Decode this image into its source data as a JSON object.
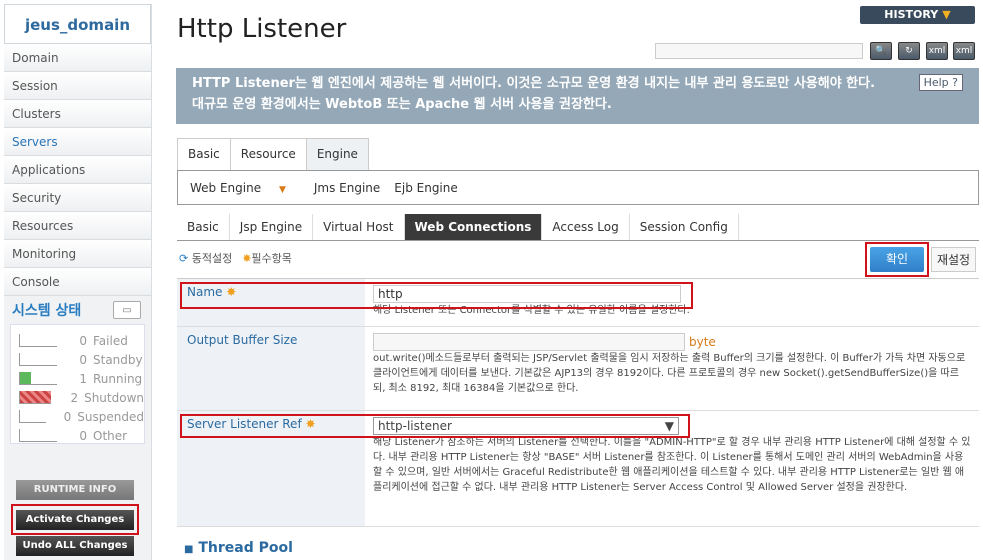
{
  "sidebar": {
    "domain": "jeus_domain",
    "items": [
      {
        "label": "Domain"
      },
      {
        "label": "Session"
      },
      {
        "label": "Clusters"
      },
      {
        "label": "Servers"
      },
      {
        "label": "Applications"
      },
      {
        "label": "Security"
      },
      {
        "label": "Resources"
      },
      {
        "label": "Monitoring"
      },
      {
        "label": "Console"
      }
    ],
    "status_title": "시스템 상태",
    "status": [
      {
        "count": "0",
        "label": "Failed"
      },
      {
        "count": "0",
        "label": "Standby"
      },
      {
        "count": "1",
        "label": "Running"
      },
      {
        "count": "2",
        "label": "Shutdown"
      },
      {
        "count": "0",
        "label": "Suspended"
      },
      {
        "count": "0",
        "label": "Other"
      }
    ],
    "runtime_info": "RUNTIME INFO",
    "activate": "Activate Changes",
    "undo": "Undo ALL Changes"
  },
  "header": {
    "title": "Http Listener",
    "history": "HISTORY",
    "search_placeholder": ""
  },
  "banner": {
    "text": "HTTP Listener는 웹 엔진에서 제공하는 웹 서버이다. 이것은 소규모 운영 환경 내지는 내부 관리 용도로만 사용해야 한다. 대규모 운영 환경에서는 WebtoB 또는 Apache 웹 서버 사용을 권장한다.",
    "help": "Help"
  },
  "tabs": [
    "Basic",
    "Resource",
    "Engine"
  ],
  "engine_tabs": [
    "Web Engine",
    "Jms Engine",
    "Ejb Engine"
  ],
  "web_tabs": [
    "Basic",
    "Jsp Engine",
    "Virtual Host",
    "Web Connections",
    "Access Log",
    "Session Config"
  ],
  "options": {
    "dynamic": "동적설정",
    "required": "필수항목"
  },
  "buttons": {
    "confirm": "확인",
    "reset": "재설정"
  },
  "form": {
    "name": {
      "label": "Name",
      "value": "http",
      "desc": "해당 Listener 또는 Connector를 식별할 수 있는 유일한 이름을 설정한다."
    },
    "buffer": {
      "label": "Output Buffer Size",
      "unit": "byte",
      "desc": "out.write()메소드들로부터 출력되는 JSP/Servlet 출력물을 임시 저장하는 출력 Buffer의 크기를 설정한다. 이 Buffer가 가득 차면 자동으로 클라이언트에게 데이터를 보낸다. 기본값은 AJP13의 경우 8192이다. 다른 프로토콜의 경우 new Socket().getSendBufferSize()을 따르되, 최소 8192, 최대 16384을 기본값으로 한다."
    },
    "listener": {
      "label": "Server Listener Ref",
      "value": "http-listener",
      "desc": "해당 Listener가 참조하는 서버의 Listener를 선택한다. 이를을 \"ADMIN-HTTP\"로 할 경우 내부 관리용 HTTP Listener에 대해 설정할 수 있다. 내부 관리용 HTTP Listener는 항상 \"BASE\" 서버 Listener를 참조한다. 이 Listener를 통해서 도메인 관리 서버의 WebAdmin을 사용할 수 있으며, 일반 서버에서는 Graceful Redistribute한 웹 애플리케이션을 테스트할 수 있다. 내부 관리용 HTTP Listener로는 일반 웹 애플리케이션에 접근할 수 없다. 내부 관리용 HTTP Listener는 Server Access Control 및 Allowed Server 설정을 권장한다."
    }
  },
  "thread_pool": "Thread Pool"
}
